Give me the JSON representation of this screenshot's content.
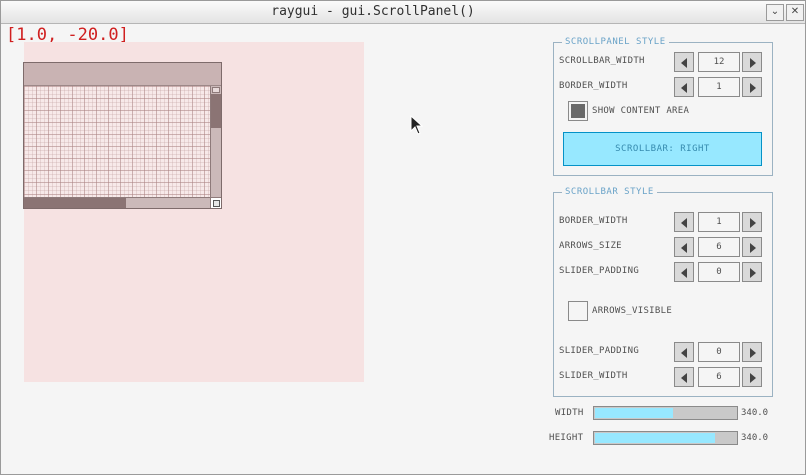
{
  "window": {
    "title": "raygui - gui.ScrollPanel()",
    "buttons": [
      "⌄",
      "✕"
    ]
  },
  "coordinates_readout": "[1.0, -20.0]",
  "scrollpanel_style": {
    "title": "SCROLLPANEL STYLE",
    "scrollbar_width": {
      "label": "SCROLLBAR_WIDTH",
      "value": "12"
    },
    "border_width": {
      "label": "BORDER_WIDTH",
      "value": "1"
    },
    "show_content_area": {
      "label": "SHOW CONTENT AREA",
      "checked": true
    },
    "scrollbar_side_button": "SCROLLBAR: RIGHT"
  },
  "scrollbar_style": {
    "title": "SCROLLBAR STYLE",
    "border_width": {
      "label": "BORDER_WIDTH",
      "value": "1"
    },
    "arrows_size": {
      "label": "ARROWS_SIZE",
      "value": "6"
    },
    "slider_padding_1": {
      "label": "SLIDER_PADDING",
      "value": "0"
    },
    "arrows_visible": {
      "label": "ARROWS_VISIBLE",
      "checked": false
    },
    "slider_padding_2": {
      "label": "SLIDER_PADDING",
      "value": "0"
    },
    "slider_width": {
      "label": "SLIDER_WIDTH",
      "value": "6"
    }
  },
  "content_size": {
    "width": {
      "label": "WIDTH",
      "value": "340.0",
      "fraction": 0.55
    },
    "height": {
      "label": "HEIGHT",
      "value": "340.0",
      "fraction": 0.85
    }
  },
  "colors": {
    "accent_fill": "#97e8ff",
    "accent_border": "#0492c7",
    "group_title": "#6aa3c8",
    "coord_text": "#d02020",
    "content_area": "#f6e2e2"
  }
}
